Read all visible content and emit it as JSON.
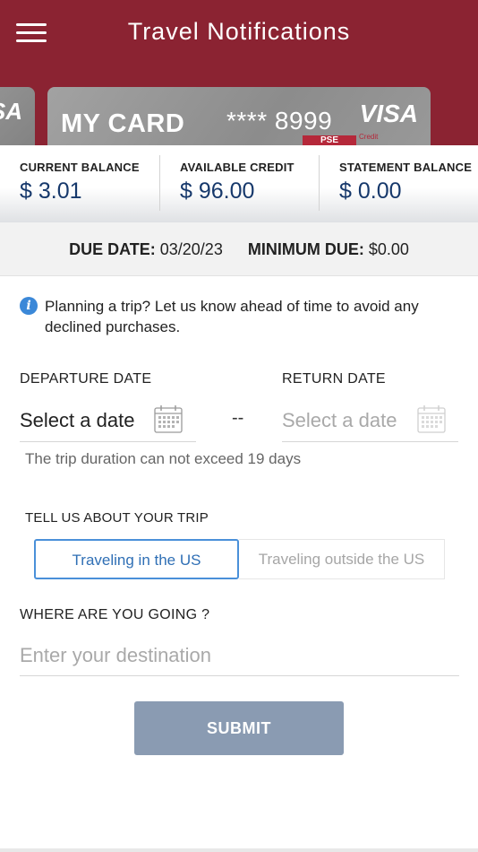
{
  "header": {
    "title": "Travel Notifications",
    "menu_icon": "hamburger-menu-icon",
    "background_color": "#8b2332"
  },
  "cards": {
    "prev_card_logo_fragment": "SA",
    "main": {
      "name": "MY CARD",
      "number_masked": "**** 8999",
      "network": "VISA",
      "bank_mark": "PSE",
      "bank_mark_sub": "Credit"
    }
  },
  "balances": [
    {
      "label": "CURRENT BALANCE",
      "value": "$ 3.01"
    },
    {
      "label": "AVAILABLE CREDIT",
      "value": "$ 96.00"
    },
    {
      "label": "STATEMENT BALANCE",
      "value": "$ 0.00"
    }
  ],
  "due": {
    "due_date_label": "DUE DATE:",
    "due_date_value": "03/20/23",
    "minimum_due_label": "MINIMUM DUE:",
    "minimum_due_value": "$0.00"
  },
  "info": {
    "icon": "info-icon",
    "text": "Planning a trip? Let us know ahead of time to avoid any declined purchases."
  },
  "dates": {
    "departure_label": "DEPARTURE DATE",
    "departure_value": "Select a date",
    "return_label": "RETURN DATE",
    "return_value": "Select a date",
    "separator": "--",
    "hint": "The trip duration can not exceed 19 days"
  },
  "trip": {
    "label": "TELL US ABOUT YOUR TRIP",
    "options": [
      "Traveling in the US",
      "Traveling outside the US"
    ],
    "selected": "Traveling in the US"
  },
  "destination": {
    "label": "WHERE ARE YOU GOING ?",
    "placeholder": "Enter your destination",
    "value": ""
  },
  "submit": {
    "label": "SUBMIT",
    "color": "#8a9bb2"
  },
  "colors": {
    "accent": "#4a90d9",
    "balance_value": "#16386b",
    "info": "#3b88d8"
  }
}
